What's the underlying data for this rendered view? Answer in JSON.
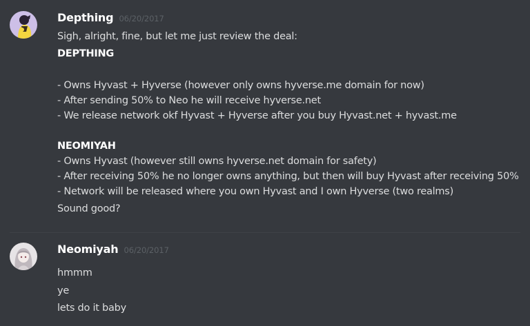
{
  "messages": [
    {
      "username": "Depthing",
      "timestamp": "06/20/2017",
      "avatar_icon": "user-avatar-icon",
      "lines": [
        "Sigh, alright, fine, but let me just review the deal:",
        "DEPTHING",
        "- Owns Hyvast + Hyverse (however only owns hyverse.me domain for now)",
        "- After sending 50% to Neo he will receive hyverse.net",
        "- We release network okf Hyvast + Hyverse after you buy Hyvast.net + hyvast.me",
        "NEOMIYAH",
        "- Owns Hyvast (however still owns hyverse.net domain for safety)",
        "- After receiving 50% he no longer owns anything, but then will buy Hyvast after receiving 50%",
        "- Network will be released where you own Hyvast and I own Hyverse (two realms)",
        "Sound good?"
      ]
    },
    {
      "username": "Neomiyah",
      "timestamp": "06/20/2017",
      "avatar_icon": "user-avatar-icon",
      "lines": [
        "hmmm",
        "ye",
        "lets do it baby"
      ]
    }
  ],
  "colors": {
    "background": "#36393e",
    "username": "#ffffff",
    "timestamp": "#5c6166",
    "text": "#dcddde",
    "divider": "#3f4247"
  }
}
